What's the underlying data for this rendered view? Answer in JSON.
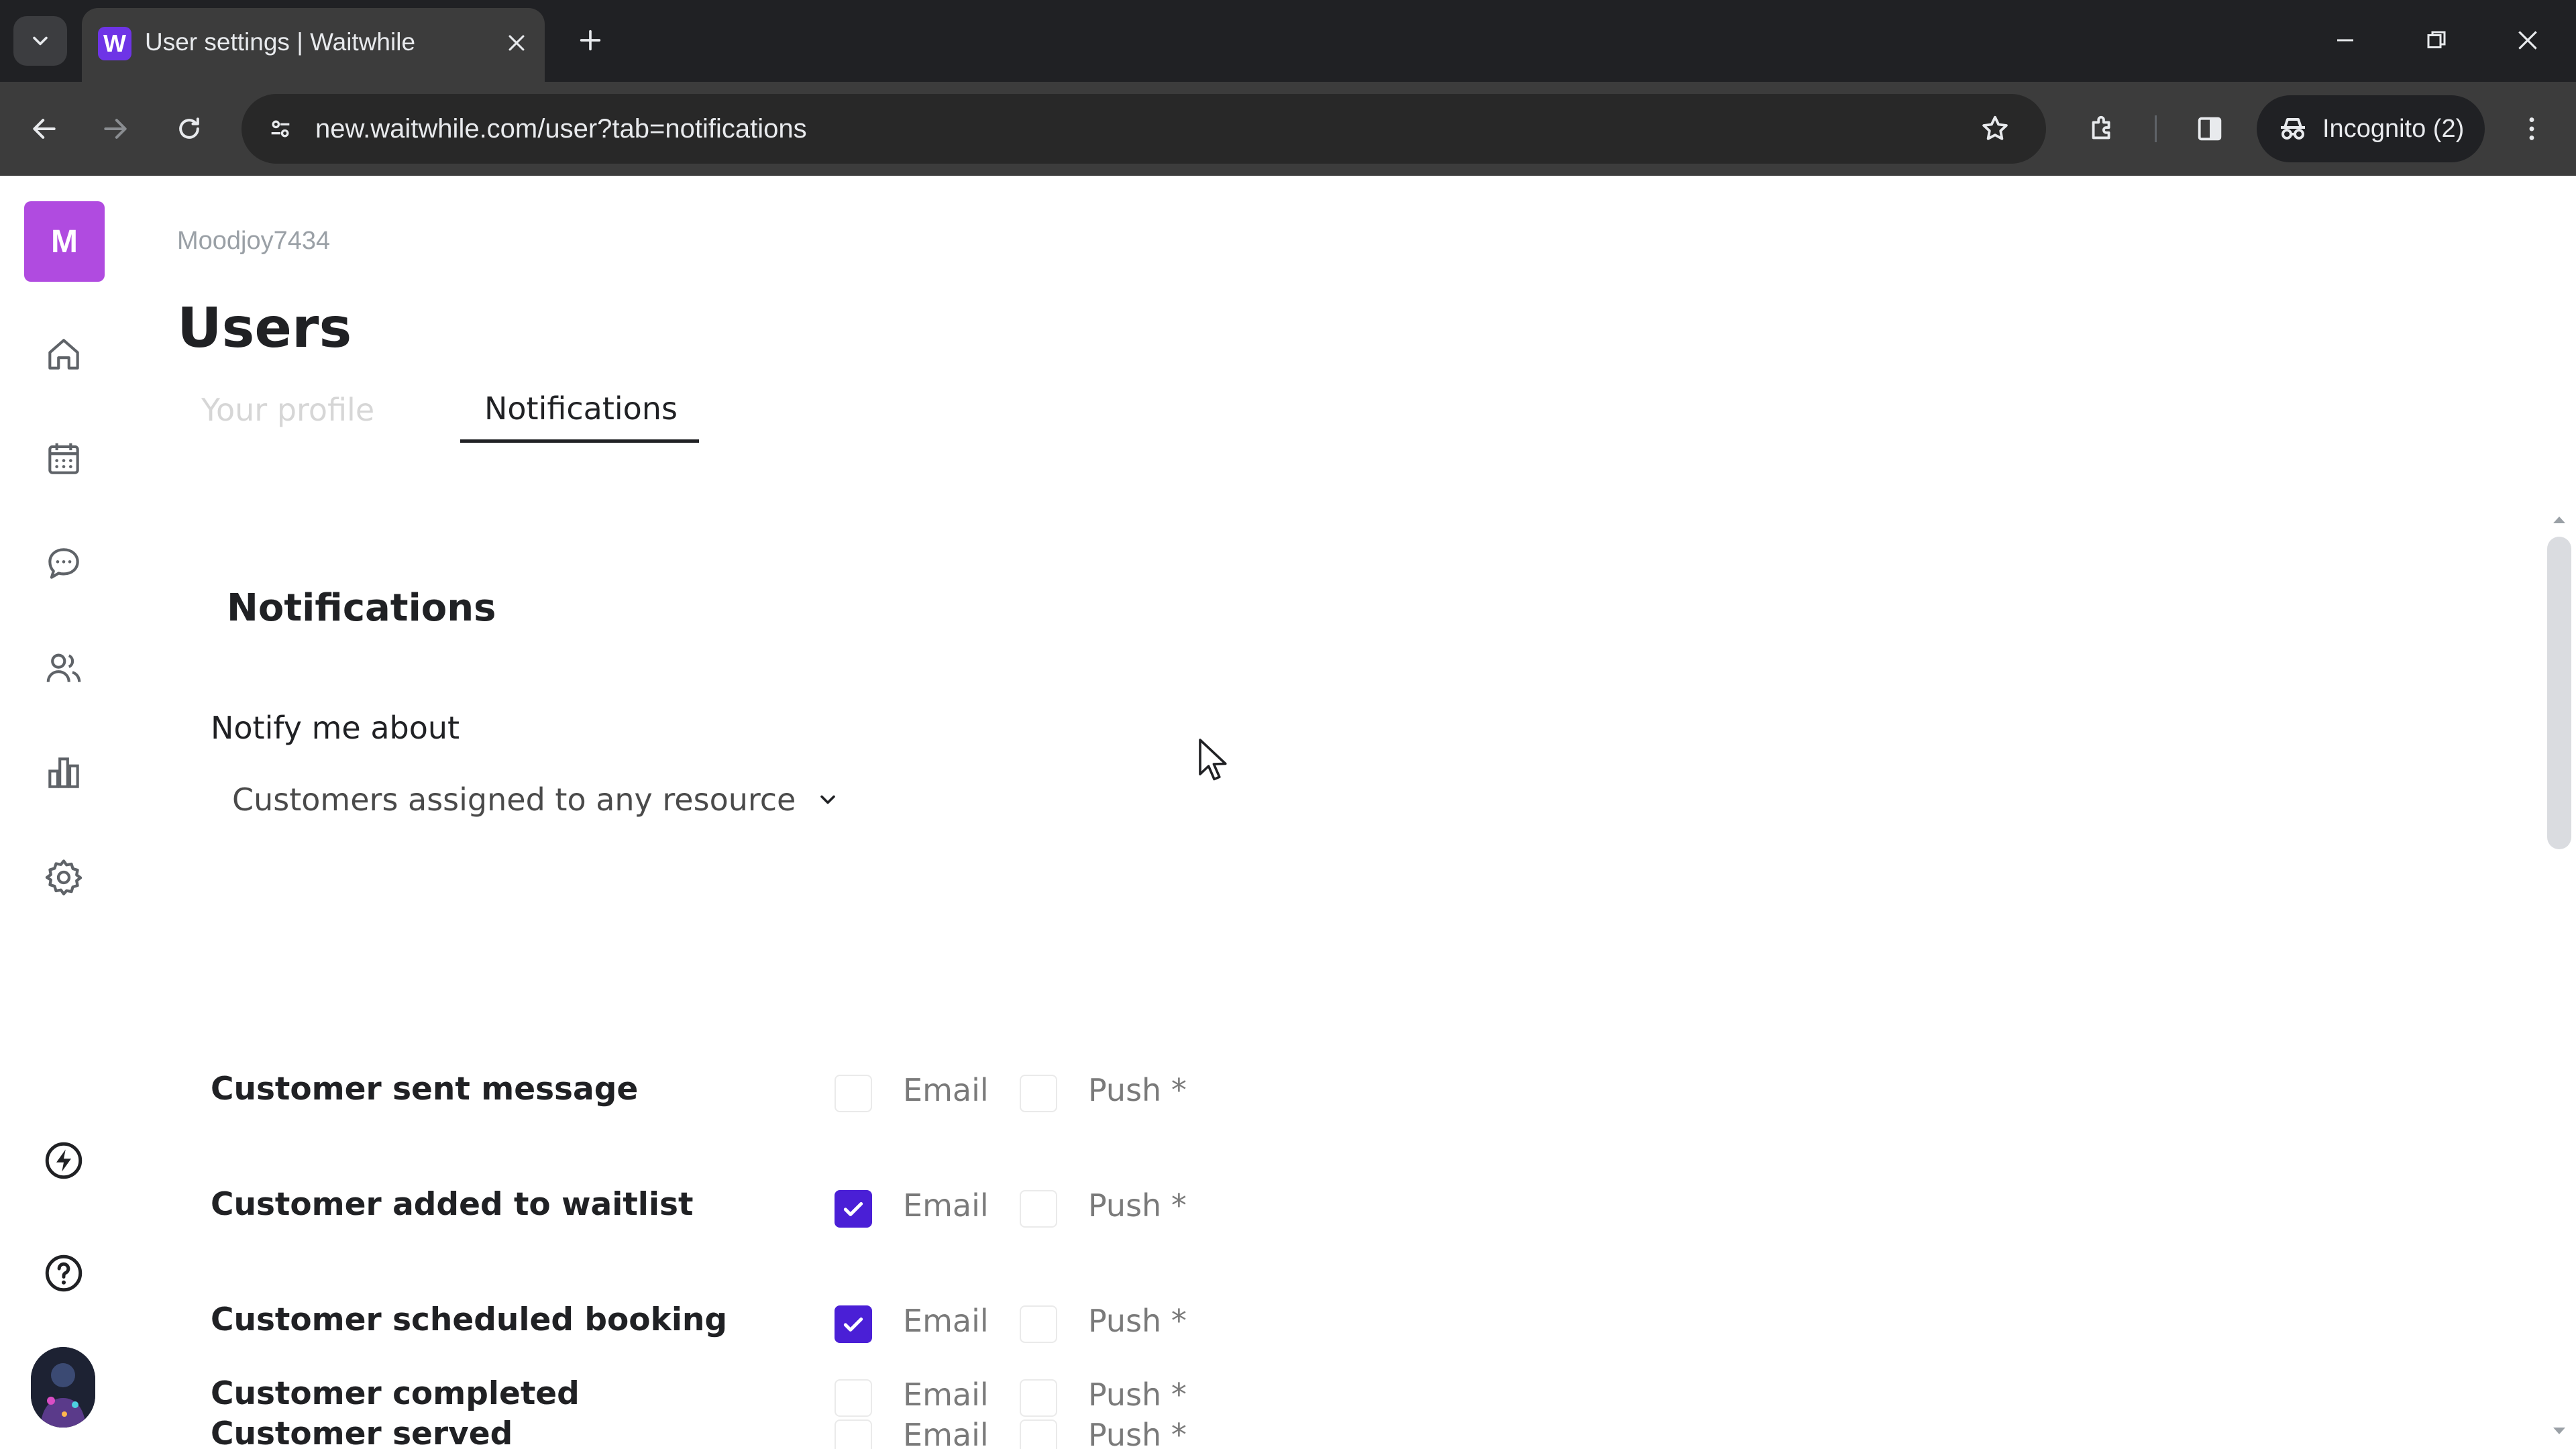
{
  "browser": {
    "tab_title": "User settings | Waitwhile",
    "favicon_letter": "W",
    "url": "new.waitwhile.com/user?tab=notifications",
    "incognito_label": "Incognito (2)"
  },
  "sidebar": {
    "org_initial": "M",
    "items": [
      {
        "name": "home-icon"
      },
      {
        "name": "calendar-icon"
      },
      {
        "name": "messages-icon"
      },
      {
        "name": "customers-icon"
      },
      {
        "name": "analytics-icon"
      },
      {
        "name": "settings-icon"
      }
    ],
    "bottom_items": [
      {
        "name": "lightning-icon"
      },
      {
        "name": "help-icon"
      }
    ]
  },
  "main": {
    "org_name": "Moodjoy7434",
    "page_title": "Users",
    "tabs": [
      {
        "label": "Your profile",
        "active": false
      },
      {
        "label": "Notifications",
        "active": true
      }
    ],
    "section_title": "Notifications",
    "notify_label": "Notify me about",
    "notify_value": "Customers assigned to any resource",
    "notifications": [
      {
        "label": "Customer sent message",
        "email": false,
        "push": false,
        "email_label": "Email",
        "push_label": "Push *"
      },
      {
        "label": "Customer added to waitlist",
        "email": true,
        "push": false,
        "email_label": "Email",
        "push_label": "Push *"
      },
      {
        "label": "Customer scheduled booking",
        "email": true,
        "push": false,
        "email_label": "Email",
        "push_label": "Push *"
      },
      {
        "label": "Customer served",
        "email": false,
        "push": false,
        "email_label": "Email",
        "push_label": "Push *"
      },
      {
        "label": "Customer completed",
        "email": false,
        "push": false,
        "email_label": "Email",
        "push_label": "Push *"
      }
    ]
  },
  "colors": {
    "accent": "#4a1fd6",
    "org_avatar": "#b04be0",
    "chrome_bg": "#202124",
    "toolbar_bg": "#3c3c3c"
  }
}
